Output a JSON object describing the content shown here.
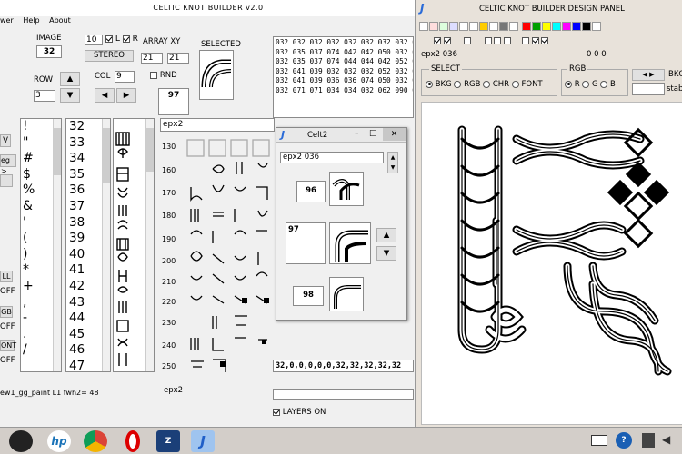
{
  "main": {
    "title": "CELTIC KNOT BUILDER  v2.0",
    "menu": [
      "wer",
      "Help",
      "About"
    ],
    "image_label": "IMAGE",
    "image_value": "32",
    "num_box": "10",
    "l_label": "L",
    "r_label": "R",
    "array_label": "ARRAY XY",
    "array_x": "21",
    "array_y": "21",
    "stereo_label": "STEREO",
    "row_label": "ROW",
    "row_value": "3",
    "col_label": "COL",
    "col_value": "9",
    "rnd_label": "RND",
    "small_value": "97",
    "selected_label": "SELECTED",
    "codes": [
      "032 032 032 032 032 032 032 032 032",
      "032 035 037 074 042 042 050 032 032",
      "032 035 037 074 044 044 042 052 032",
      "032 041 039 032 032 032 052 032 032",
      "032 041 039 036 036 074 050 032 032",
      "032 071 071 034 034 032 062 090 032"
    ],
    "side_buttons": [
      "V",
      "eg >",
      "",
      "LL",
      "OFF",
      "GB",
      "OFF",
      "ONT",
      "OFF"
    ],
    "chars": [
      "!",
      "\"",
      "#",
      "$",
      "%",
      "&",
      "'",
      "(",
      ")",
      "*",
      "+",
      ",",
      "-",
      ".",
      "/"
    ],
    "nums": [
      "32",
      "33",
      "34",
      "35",
      "36",
      "37",
      "38",
      "39",
      "40",
      "41",
      "42",
      "43",
      "44",
      "45",
      "46",
      "47"
    ],
    "set_name": "epx2",
    "row_nums": [
      "130",
      "160",
      "170",
      "180",
      "190",
      "200",
      "210",
      "220",
      "230",
      "240",
      "250"
    ],
    "bottom_values": "32,0,0,0,0,0,32,32,32,32,32",
    "layers_label": "LAYERS ON",
    "status": "ew1_gg_paint L1 fwh2= 48",
    "bottom_set": "epx2"
  },
  "celt2": {
    "title": "Celt2",
    "field": "epx2 036",
    "values": [
      "96",
      "97",
      "98"
    ]
  },
  "design": {
    "title": "CELTIC KNOT BUILDER DESIGN PANEL",
    "tile_name": "epx2 036",
    "coords": "0 0 0",
    "select_label": "SELECT",
    "select_options": [
      "BKG",
      "RGB",
      "CHR",
      "FONT"
    ],
    "rgb_label": "RGB",
    "rgb_options": [
      "R",
      "G",
      "B"
    ],
    "bkg_label": "BKG",
    "stab_label": "stab",
    "colors": {
      "red": "#ff0000",
      "green": "#00a000",
      "yellow": "#ffff00",
      "cyan": "#00ffff",
      "magenta": "#ff00ff",
      "blue": "#0000ff",
      "black": "#000000",
      "white": "#ffffff"
    }
  },
  "taskbar": {
    "apps": [
      "camera-app",
      "hp-app",
      "chrome-app",
      "opera-app",
      "zip-app",
      "java-app"
    ]
  }
}
